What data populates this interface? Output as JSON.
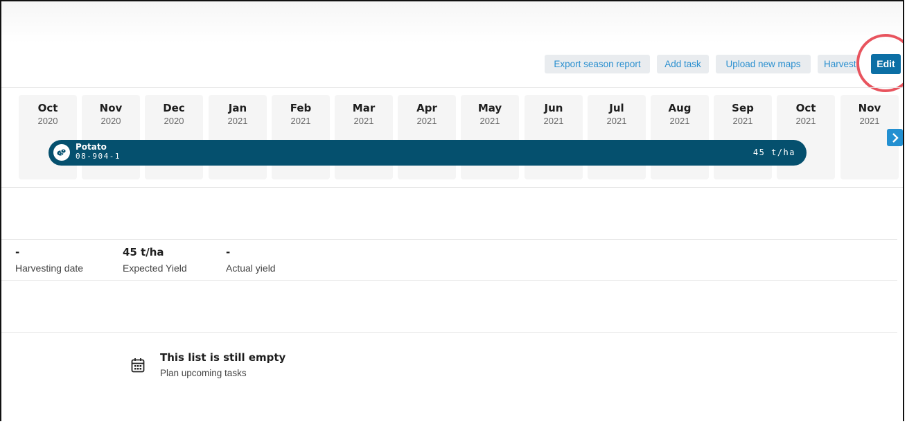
{
  "toolbar": {
    "export_label": "Export season report",
    "add_task_label": "Add task",
    "upload_label": "Upload new maps",
    "harvest_label": "Harvest",
    "edit_label": "Edit"
  },
  "timeline": {
    "months": [
      {
        "month": "Oct",
        "year": "2020"
      },
      {
        "month": "Nov",
        "year": "2020"
      },
      {
        "month": "Dec",
        "year": "2020"
      },
      {
        "month": "Jan",
        "year": "2021"
      },
      {
        "month": "Feb",
        "year": "2021"
      },
      {
        "month": "Mar",
        "year": "2021"
      },
      {
        "month": "Apr",
        "year": "2021"
      },
      {
        "month": "May",
        "year": "2021"
      },
      {
        "month": "Jun",
        "year": "2021"
      },
      {
        "month": "Jul",
        "year": "2021"
      },
      {
        "month": "Aug",
        "year": "2021"
      },
      {
        "month": "Sep",
        "year": "2021"
      },
      {
        "month": "Oct",
        "year": "2021"
      },
      {
        "month": "Nov",
        "year": "2021"
      }
    ],
    "crop": {
      "name": "Potato",
      "code": "08-904-1",
      "yield": "45 t/ha",
      "icon": "potato-icon",
      "color": "#05506e"
    },
    "next_icon": "chevron-right-icon"
  },
  "stats": {
    "harvesting_date": {
      "value": "-",
      "label": "Harvesting date"
    },
    "expected_yield": {
      "value": "45 t/ha",
      "label": "Expected Yield"
    },
    "actual_yield": {
      "value": "-",
      "label": "Actual yield"
    }
  },
  "tasks": {
    "empty_title": "This list is still empty",
    "empty_subtitle": "Plan upcoming tasks",
    "icon": "calendar-icon"
  },
  "colors": {
    "accent": "#0c6fa5",
    "link": "#2a8fcf",
    "highlight": "#e8545e"
  }
}
